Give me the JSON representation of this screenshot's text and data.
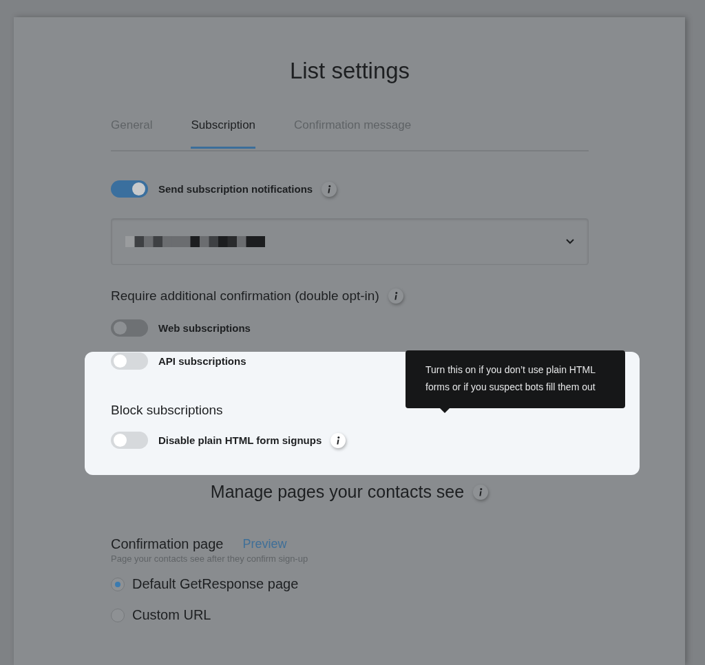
{
  "title": "List settings",
  "tabs": [
    {
      "label": "General",
      "selected": false
    },
    {
      "label": "Subscription",
      "selected": true
    },
    {
      "label": "Confirmation message",
      "selected": false
    }
  ],
  "notifications": {
    "label": "Send subscription notifications",
    "on": true
  },
  "double_opt_in": {
    "heading": "Require additional confirmation (double opt-in)",
    "toggles": [
      {
        "label": "Web subscriptions",
        "on": false,
        "highlighted": false
      },
      {
        "label": "API subscriptions",
        "on": false,
        "highlighted": true
      }
    ]
  },
  "block": {
    "heading": "Block subscriptions",
    "toggles": [
      {
        "label": "Disable plain HTML form signups",
        "on": false
      }
    ]
  },
  "tooltip": {
    "text": "Turn this on if you don’t use plain HTML forms or if you suspect bots fill them out"
  },
  "pages": {
    "heading": "Manage pages your contacts see",
    "confirmation": {
      "title": "Confirmation page",
      "link": "Preview",
      "subtitle": "Page your contacts see after they confirm sign-up",
      "options": [
        {
          "label": "Default GetResponse page",
          "selected": true
        },
        {
          "label": "Custom URL",
          "selected": false
        }
      ]
    }
  }
}
